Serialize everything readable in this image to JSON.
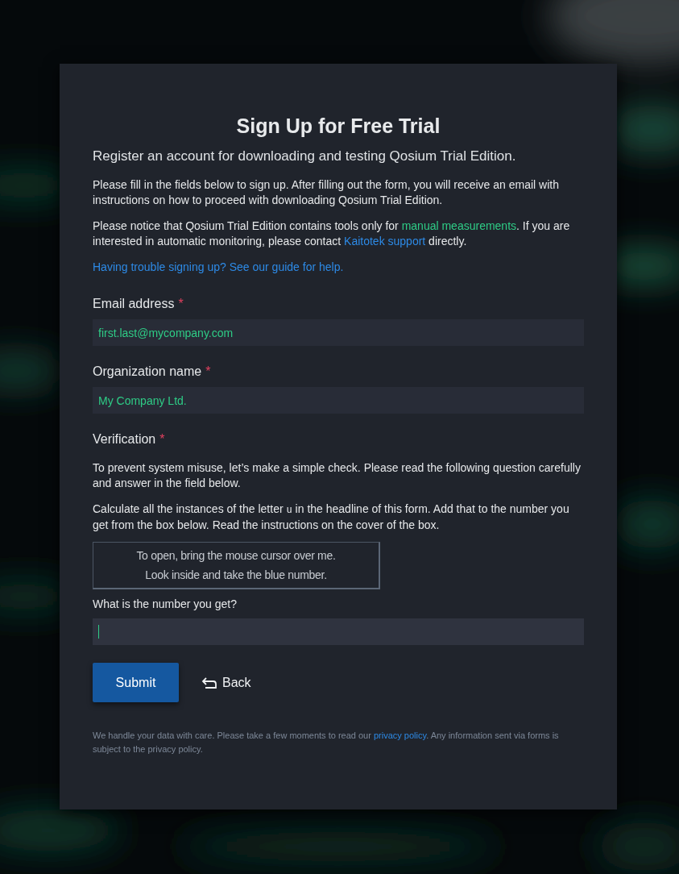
{
  "title": "Sign Up for Free Trial",
  "subtitle": "Register an account for downloading and testing Qosium Trial Edition.",
  "intro": [
    [
      {
        "text": "Please fill in the fields below to sign up. After filling out the form, you will receive an email with instructions on how to proceed with downloading Qosium Trial Edition."
      }
    ],
    [
      {
        "text": "Please notice that Qosium Trial Edition contains tools only for "
      },
      {
        "text": "manual measurements",
        "kind": "accent"
      },
      {
        "text": ". If you are interested in automatic monitoring, please contact "
      },
      {
        "text": "Kaitotek support",
        "kind": "link"
      },
      {
        "text": " directly."
      }
    ]
  ],
  "help_link": "Having trouble signing up? See our guide for help.",
  "fields": [
    {
      "label": "Email address",
      "required_mark": "*",
      "value": "first.last@mycompany.com"
    },
    {
      "label": "Organization name",
      "required_mark": "*",
      "value": "My Company Ltd."
    }
  ],
  "verification": {
    "label": "Verification",
    "required_mark": "*",
    "paragraphs": [
      [
        {
          "text": "To prevent system misuse, let’s make a simple check. Please read the following question carefully and answer in the field below."
        }
      ],
      [
        {
          "text": "Calculate all the instances of the letter "
        },
        {
          "text": "u",
          "kind": "code"
        },
        {
          "text": " in the headline of this form. Add that to the number you get from the box below. Read the instructions on the cover of the box."
        }
      ]
    ],
    "box_lines": [
      "To open, bring the mouse cursor over me.",
      "Look inside and take the blue number."
    ],
    "question": "What is the number you get?",
    "answer": {
      "focused": true
    }
  },
  "buttons": {
    "submit": "Submit",
    "back": "Back"
  },
  "footer": [
    {
      "text": "We handle your data with care. Please take a few moments to read our "
    },
    {
      "text": "privacy policy",
      "kind": "link"
    },
    {
      "text": ". Any information sent via forms is subject to the privacy policy."
    }
  ]
}
